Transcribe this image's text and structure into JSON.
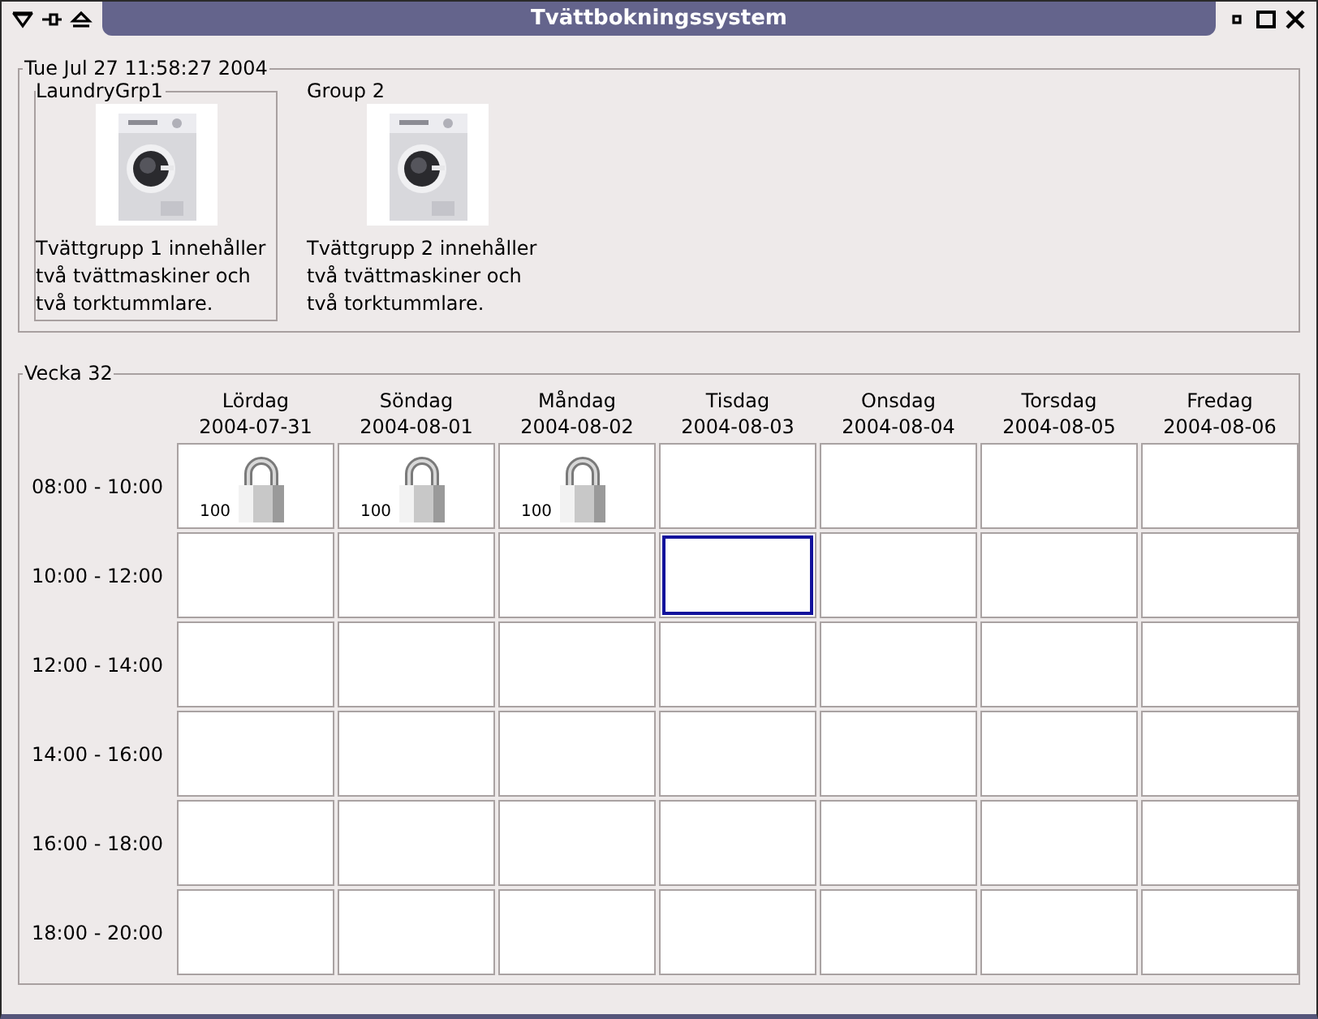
{
  "window": {
    "title": "Tvättbokningssystem"
  },
  "session": {
    "timestamp": "Tue Jul 27 11:58:27 2004",
    "groups": [
      {
        "name": "LaundryGrp1",
        "description": "Tvättgrupp 1 innehåller två tvättmaskiner och två torktummlare.",
        "selected": true
      },
      {
        "name": "Group 2",
        "description": "Tvättgrupp 2 innehåller två tvättmaskiner och två torktummlare.",
        "selected": false
      }
    ]
  },
  "week": {
    "title": "Vecka 32",
    "days": [
      {
        "name": "Lördag",
        "date": "2004-07-31"
      },
      {
        "name": "Söndag",
        "date": "2004-08-01"
      },
      {
        "name": "Måndag",
        "date": "2004-08-02"
      },
      {
        "name": "Tisdag",
        "date": "2004-08-03"
      },
      {
        "name": "Onsdag",
        "date": "2004-08-04"
      },
      {
        "name": "Torsdag",
        "date": "2004-08-05"
      },
      {
        "name": "Fredag",
        "date": "2004-08-06"
      }
    ],
    "slots": [
      {
        "time": "08:00 - 10:00",
        "cells": [
          {
            "locked": true,
            "label": "100",
            "selected": false
          },
          {
            "locked": true,
            "label": "100",
            "selected": false
          },
          {
            "locked": true,
            "label": "100",
            "selected": false
          },
          {
            "locked": false,
            "selected": false
          },
          {
            "locked": false,
            "selected": false
          },
          {
            "locked": false,
            "selected": false
          },
          {
            "locked": false,
            "selected": false
          }
        ]
      },
      {
        "time": "10:00 - 12:00",
        "cells": [
          {
            "locked": false,
            "selected": false
          },
          {
            "locked": false,
            "selected": false
          },
          {
            "locked": false,
            "selected": false
          },
          {
            "locked": false,
            "selected": true
          },
          {
            "locked": false,
            "selected": false
          },
          {
            "locked": false,
            "selected": false
          },
          {
            "locked": false,
            "selected": false
          }
        ]
      },
      {
        "time": "12:00 - 14:00",
        "cells": [
          {
            "locked": false,
            "selected": false
          },
          {
            "locked": false,
            "selected": false
          },
          {
            "locked": false,
            "selected": false
          },
          {
            "locked": false,
            "selected": false
          },
          {
            "locked": false,
            "selected": false
          },
          {
            "locked": false,
            "selected": false
          },
          {
            "locked": false,
            "selected": false
          }
        ]
      },
      {
        "time": "14:00 - 16:00",
        "cells": [
          {
            "locked": false,
            "selected": false
          },
          {
            "locked": false,
            "selected": false
          },
          {
            "locked": false,
            "selected": false
          },
          {
            "locked": false,
            "selected": false
          },
          {
            "locked": false,
            "selected": false
          },
          {
            "locked": false,
            "selected": false
          },
          {
            "locked": false,
            "selected": false
          }
        ]
      },
      {
        "time": "16:00 - 18:00",
        "cells": [
          {
            "locked": false,
            "selected": false
          },
          {
            "locked": false,
            "selected": false
          },
          {
            "locked": false,
            "selected": false
          },
          {
            "locked": false,
            "selected": false
          },
          {
            "locked": false,
            "selected": false
          },
          {
            "locked": false,
            "selected": false
          },
          {
            "locked": false,
            "selected": false
          }
        ]
      },
      {
        "time": "18:00 - 20:00",
        "cells": [
          {
            "locked": false,
            "selected": false
          },
          {
            "locked": false,
            "selected": false
          },
          {
            "locked": false,
            "selected": false
          },
          {
            "locked": false,
            "selected": false
          },
          {
            "locked": false,
            "selected": false
          },
          {
            "locked": false,
            "selected": false
          },
          {
            "locked": false,
            "selected": false
          }
        ]
      }
    ]
  }
}
